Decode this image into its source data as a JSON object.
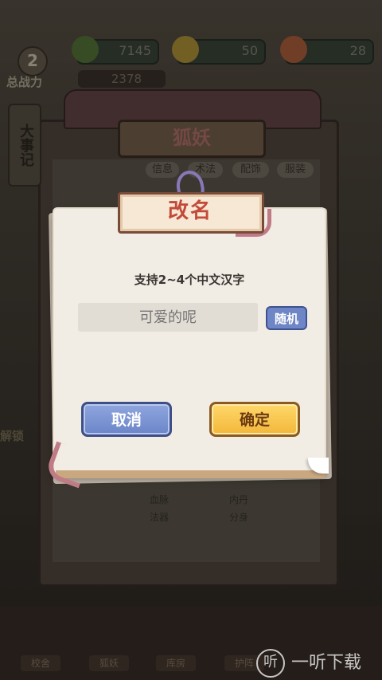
{
  "top_bar": {
    "jade": "7145",
    "coins": "50",
    "peaches": "28"
  },
  "power": {
    "level": "2",
    "label": "总战力",
    "value": "2378"
  },
  "background_panel": {
    "title": "狐妖",
    "side_tab": "大事记",
    "tabs": [
      "信息",
      "术法",
      "配饰",
      "服装"
    ],
    "stats": [
      {
        "key": "血脉",
        "value": "内丹"
      },
      {
        "key": "法器",
        "value": "分身"
      }
    ],
    "left_unlock": "解锁",
    "bottom_nav": [
      "校舍",
      "狐妖",
      "库房",
      "护阵"
    ]
  },
  "dialog": {
    "title": "改名",
    "hint": "支持2~4个中文汉字",
    "name_placeholder": "可爱的呢",
    "random_label": "随机",
    "cancel_label": "取消",
    "confirm_label": "确定"
  },
  "watermark": {
    "text": "一听下载",
    "icon": "听"
  },
  "colors": {
    "title_red": "#c24a3a",
    "cancel_blue": "#6b85c8",
    "confirm_gold": "#f2b73a",
    "paper": "#f1ece4"
  }
}
